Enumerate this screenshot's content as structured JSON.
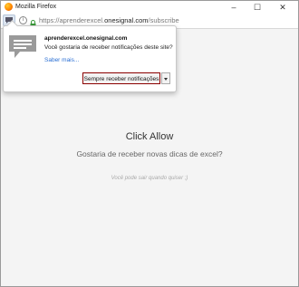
{
  "window": {
    "title": "Mozilla Firefox",
    "controls": [
      "–",
      "☐",
      "✕"
    ]
  },
  "navbar": {
    "url_prefix": "https://aprenderexcel.",
    "url_host": "onesignal.com",
    "url_path": "/subscribe",
    "info_glyph": "i"
  },
  "notification": {
    "host": "aprenderexcel.onesignal.com",
    "question": "Você gostaria de receber notificações deste site?",
    "learn_more": "Saber mais...",
    "allow_button": "Sempre receber notificações"
  },
  "page": {
    "heading": "Click Allow",
    "subheading": "Gostaria de receber novas dicas de excel?",
    "hint": "Você pode sair quando quiser ;)"
  },
  "colors": {
    "allow_border": "#8b0000",
    "link": "#2a6fd4"
  }
}
